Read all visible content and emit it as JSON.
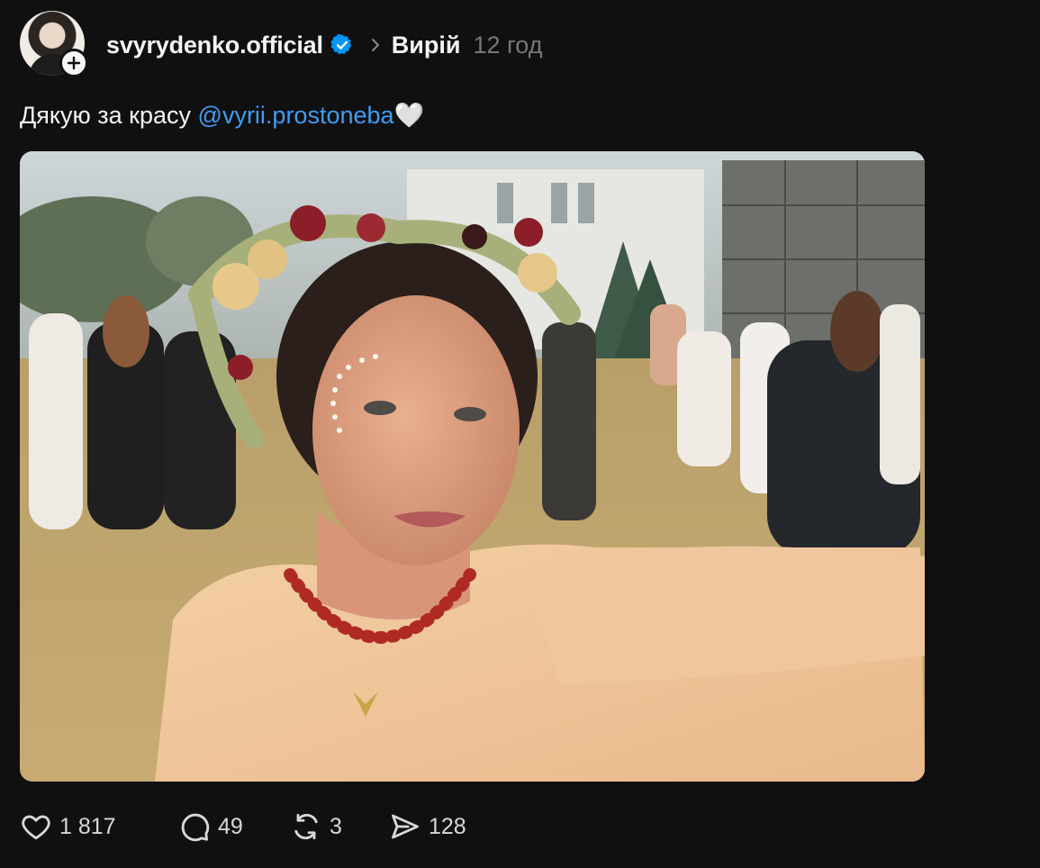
{
  "post": {
    "author": {
      "username": "svyrydenko.official",
      "verified": true
    },
    "community": "Вирій",
    "time_ago": "12 год",
    "caption": {
      "text": "Дякую за красу ",
      "mention": "@vyrii.prostoneba",
      "emoji": "🤍"
    },
    "image_alt": "selfie photo",
    "stats": {
      "likes": "1 817",
      "comments": "49",
      "reposts": "3",
      "shares": "128"
    }
  },
  "icons": {
    "follow": "plus-icon",
    "verified": "verified-badge-icon",
    "chevron": "chevron-right-icon",
    "like": "heart-icon",
    "comment": "comment-bubble-icon",
    "repost": "repost-icon",
    "share": "send-icon"
  },
  "colors": {
    "background": "#101010",
    "text": "#f3f5f7",
    "muted": "#777777",
    "mention": "#3f9cf5",
    "verified": "#0095f6"
  }
}
